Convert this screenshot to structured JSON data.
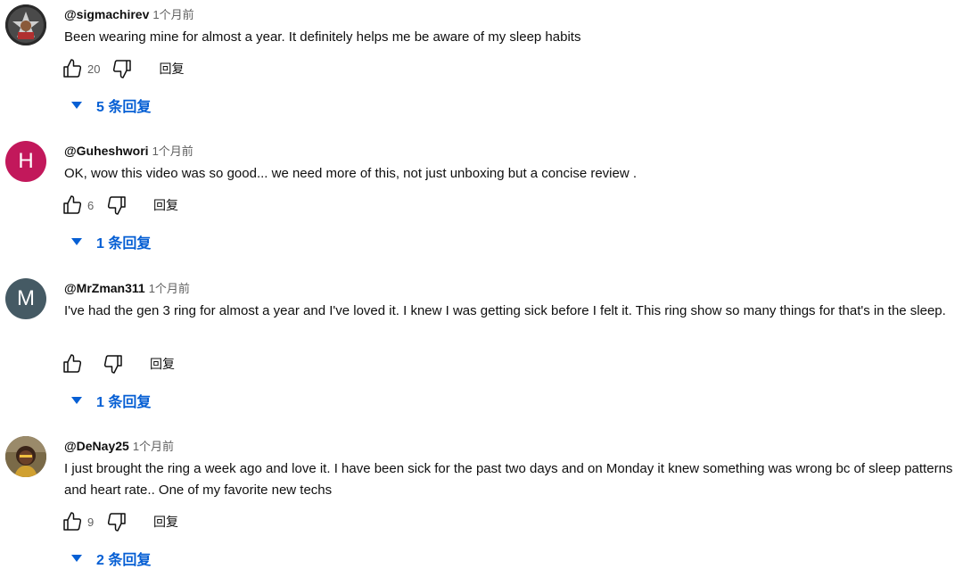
{
  "comments": [
    {
      "author": "@sigmachirev",
      "time": "1个月前",
      "text": "Been wearing mine for almost a year. It definitely helps me be aware of my sleep habits",
      "likes": "20",
      "reply_label": "回复",
      "replies_label": "5 条回复",
      "avatar_letter": "",
      "avatar_color": "#3a3a3a"
    },
    {
      "author": "@Guheshwori",
      "time": "1个月前",
      "text": "OK, wow this video was so good... we need more of this, not just unboxing but a concise review .",
      "likes": "6",
      "reply_label": "回复",
      "replies_label": "1 条回复",
      "avatar_letter": "H",
      "avatar_color": "#c2185b"
    },
    {
      "author": "@MrZman311",
      "time": "1个月前",
      "text": "I've had the gen 3 ring for almost a year and I've loved it. I knew I was getting sick before I felt it. This ring show so many things for that's in the sleep.",
      "likes": "",
      "reply_label": "回复",
      "replies_label": "1 条回复",
      "avatar_letter": "M",
      "avatar_color": "#455a64"
    },
    {
      "author": "@DeNay25",
      "time": "1个月前",
      "text": "I just brought the ring a week ago and love it. I have been sick for the past two days and  on Monday it knew something was wrong bc of sleep patterns and heart rate.. One of my favorite new techs",
      "likes": "9",
      "reply_label": "回复",
      "replies_label": "2 条回复",
      "avatar_letter": "",
      "avatar_color": "#6b5a3a"
    }
  ],
  "icons": {
    "like": "thumb-up-icon",
    "dislike": "thumb-down-icon",
    "expand": "caret-down-icon"
  },
  "colors": {
    "link_blue": "#065fd4",
    "meta_gray": "#606060"
  }
}
